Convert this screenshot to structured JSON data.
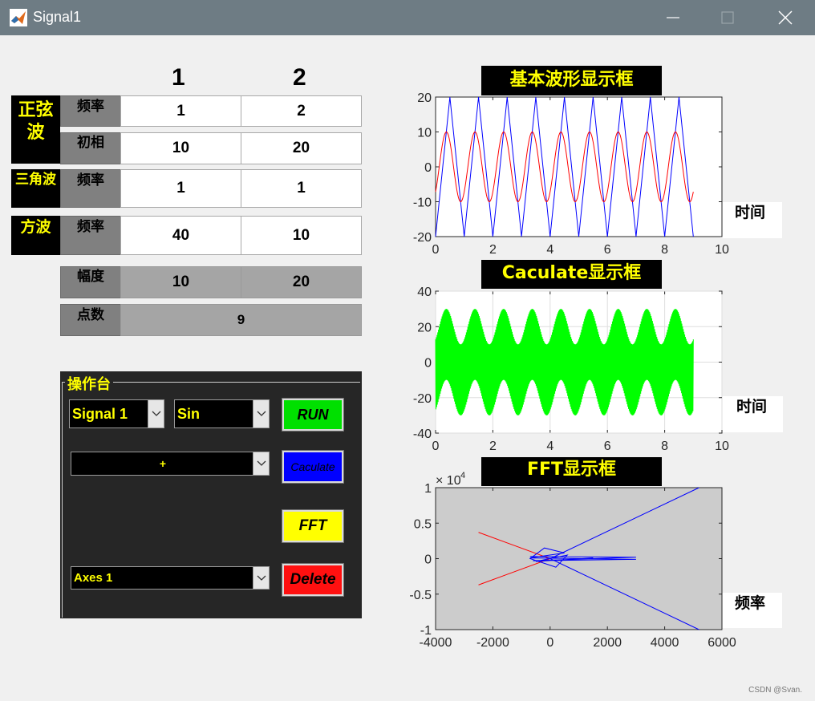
{
  "window": {
    "title": "Signal1"
  },
  "columns": [
    "1",
    "2"
  ],
  "sections": {
    "sine": "正弦\n波",
    "triangle": "三角波",
    "square": "方波"
  },
  "rows": {
    "sin_freq": {
      "label": "频率",
      "v1": "1",
      "v2": "2"
    },
    "sin_phase": {
      "label": "初相",
      "v1": "10",
      "v2": "20"
    },
    "tri_freq": {
      "label": "频率",
      "v1": "1",
      "v2": "1"
    },
    "sq_freq": {
      "label": "频率",
      "v1": "40",
      "v2": "10"
    },
    "amplitude": {
      "label": "幅度",
      "v1": "10",
      "v2": "20"
    },
    "points": {
      "label": "点数",
      "v": "9"
    }
  },
  "console": {
    "title": "操作台",
    "signal_select": "Signal 1",
    "wave_select": "Sin",
    "op_select": "+",
    "axes_select": "Axes 1",
    "run": "RUN",
    "caculate": "Caculate",
    "fft": "FFT",
    "delete": "Delete"
  },
  "axes": {
    "basic": {
      "title": "基本波形显示框",
      "xlabel": "时间",
      "xticks": [
        "0",
        "2",
        "4",
        "6",
        "8",
        "10"
      ],
      "yticks": [
        "20",
        "10",
        "0",
        "-10",
        "-20"
      ]
    },
    "caculate": {
      "title": "Caculate显示框",
      "xlabel": "时间",
      "xticks": [
        "0",
        "2",
        "4",
        "6",
        "8",
        "10"
      ],
      "yticks": [
        "40",
        "20",
        "0",
        "-20",
        "-40"
      ]
    },
    "fft": {
      "title": "FFT显示框",
      "xlabel": "频率",
      "exponent_base": "× 10",
      "exponent": "4",
      "xticks": [
        "-4000",
        "-2000",
        "0",
        "2000",
        "4000",
        "6000"
      ],
      "yticks": [
        "1",
        "0.5",
        "0",
        "-0.5",
        "-1"
      ]
    }
  },
  "chart_data": [
    {
      "type": "line",
      "title": "基本波形显示框",
      "xlabel": "时间",
      "xlim": [
        0,
        10
      ],
      "ylim": [
        -20,
        20
      ],
      "grid": false,
      "series": [
        {
          "color": "#ff0000",
          "kind": "sine",
          "amplitude": 10,
          "frequency": 1,
          "x_range": [
            0,
            9
          ]
        },
        {
          "color": "#0000ff",
          "kind": "triangle",
          "amplitude": 20,
          "frequency": 1,
          "x_range": [
            0,
            9
          ]
        }
      ]
    },
    {
      "type": "line",
      "title": "Caculate显示框",
      "xlabel": "时间",
      "xlim": [
        0,
        10
      ],
      "ylim": [
        -40,
        40
      ],
      "grid": true,
      "series": [
        {
          "color": "#00ff00",
          "kind": "modulated",
          "envelope_low": [
            -30,
            10
          ],
          "envelope_high": [
            -10,
            30
          ],
          "frequency": 1,
          "x_range": [
            0,
            9
          ]
        }
      ]
    },
    {
      "type": "line",
      "title": "FFT显示框",
      "xlabel": "频率",
      "xlim": [
        -4000,
        6000
      ],
      "ylim": [
        -1,
        1
      ],
      "y_exponent": 4,
      "series": [
        {
          "color": "#ff0000",
          "points": [
            [
              -2500,
              0.37
            ],
            [
              0,
              0
            ],
            [
              -2500,
              -0.37
            ]
          ]
        },
        {
          "color": "#0000ff",
          "points": [
            [
              5200,
              1.0
            ],
            [
              0,
              0
            ],
            [
              5200,
              -1.0
            ]
          ]
        }
      ]
    }
  ]
}
